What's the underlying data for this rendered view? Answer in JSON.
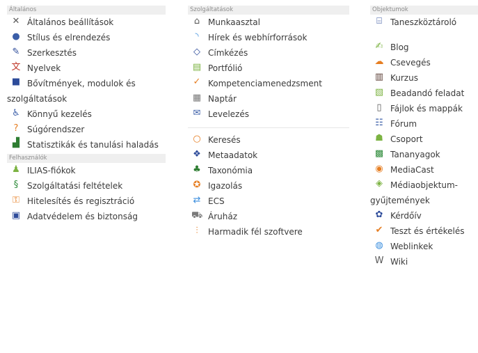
{
  "col1": {
    "section1": "Általános",
    "items1": [
      {
        "label": "Általános beállítások",
        "icon": "tools-icon",
        "color": "#5a5a5a"
      },
      {
        "label": "Stílus és elrendezés",
        "icon": "palette-icon",
        "color": "#3b5ea8"
      },
      {
        "label": "Szerkesztés",
        "icon": "pencil-icon",
        "color": "#2d4b9a"
      },
      {
        "label": "Nyelvek",
        "icon": "language-icon",
        "color": "#c0392b"
      },
      {
        "label": "Bővítmények, modulok és szolgáltatások",
        "icon": "plugin-icon",
        "color": "#2d4b9a"
      },
      {
        "label": "Könnyű kezelés",
        "icon": "accessibility-icon",
        "color": "#3b5ea8"
      },
      {
        "label": "Súgórendszer",
        "icon": "help-icon",
        "color": "#e67e22"
      },
      {
        "label": "Statisztikák és tanulási haladás",
        "icon": "chart-icon",
        "color": "#2e7d32"
      }
    ],
    "section2": "Felhasználók",
    "items2": [
      {
        "label": "ILIAS-fiókok",
        "icon": "users-icon",
        "color": "#7cb342"
      },
      {
        "label": "Szolgáltatási feltételek",
        "icon": "terms-icon",
        "color": "#2e8b3a"
      },
      {
        "label": "Hitelesítés és regisztráció",
        "icon": "key-icon",
        "color": "#e67e22"
      },
      {
        "label": "Adatvédelem és biztonság",
        "icon": "lock-icon",
        "color": "#2d4b9a"
      }
    ]
  },
  "col2": {
    "section1": "Szolgáltatások",
    "items1": [
      {
        "label": "Munkaasztal",
        "icon": "desk-icon",
        "color": "#5a5a5a"
      },
      {
        "label": "Hírek és webhírforrások",
        "icon": "rss-icon",
        "color": "#3b8ede"
      },
      {
        "label": "Címkézés",
        "icon": "tag-icon",
        "color": "#2d4b9a"
      },
      {
        "label": "Portfólió",
        "icon": "portfolio-icon",
        "color": "#7cb342"
      },
      {
        "label": "Kompetenciamenedzsment",
        "icon": "competence-icon",
        "color": "#e67e22"
      },
      {
        "label": "Naptár",
        "icon": "calendar-icon",
        "color": "#7a7a7a"
      },
      {
        "label": "Levelezés",
        "icon": "mail-icon",
        "color": "#3b5ea8"
      }
    ],
    "items2": [
      {
        "label": "Keresés",
        "icon": "search-icon",
        "color": "#e67e22"
      },
      {
        "label": "Metaadatok",
        "icon": "metadata-icon",
        "color": "#2d4b9a"
      },
      {
        "label": "Taxonómia",
        "icon": "tree-icon",
        "color": "#2e7d32"
      },
      {
        "label": "Igazolás",
        "icon": "certificate-icon",
        "color": "#e67e22"
      },
      {
        "label": "ECS",
        "icon": "ecs-icon",
        "color": "#3b8ede"
      },
      {
        "label": "Áruház",
        "icon": "shop-icon",
        "color": "#7a7a7a"
      },
      {
        "label": "Harmadik fél szoftvere",
        "icon": "sliders-icon",
        "color": "#e67e22"
      }
    ]
  },
  "col3": {
    "section1": "Objektumok",
    "items1": [
      {
        "label": "Taneszköztároló",
        "icon": "repository-icon",
        "color": "#2d4b9a"
      }
    ],
    "items2": [
      {
        "label": "Blog",
        "icon": "blog-icon",
        "color": "#7cb342"
      },
      {
        "label": "Csevegés",
        "icon": "chat-icon",
        "color": "#e67e22"
      },
      {
        "label": "Kurzus",
        "icon": "course-icon",
        "color": "#5d4037"
      },
      {
        "label": "Beadandó feladat",
        "icon": "assignment-icon",
        "color": "#7cb342"
      },
      {
        "label": "Fájlok és mappák",
        "icon": "file-icon",
        "color": "#5a5a5a"
      },
      {
        "label": "Fórum",
        "icon": "forum-icon",
        "color": "#3b5ea8"
      },
      {
        "label": "Csoport",
        "icon": "group-icon",
        "color": "#7cb342"
      },
      {
        "label": "Tananyagok",
        "icon": "learning-module-icon",
        "color": "#2e8b3a"
      },
      {
        "label": "MediaCast",
        "icon": "mediacast-icon",
        "color": "#e67e22"
      },
      {
        "label": "Médiaobjektum-gyűjtemények",
        "icon": "media-pool-icon",
        "color": "#7cb342"
      },
      {
        "label": "Kérdőív",
        "icon": "survey-icon",
        "color": "#2d4b9a"
      },
      {
        "label": "Teszt és értékelés",
        "icon": "test-icon",
        "color": "#e67e22"
      },
      {
        "label": "Weblinkek",
        "icon": "weblink-icon",
        "color": "#3b8ede"
      },
      {
        "label": "Wiki",
        "icon": "wiki-icon",
        "color": "#5a5a5a"
      }
    ]
  }
}
